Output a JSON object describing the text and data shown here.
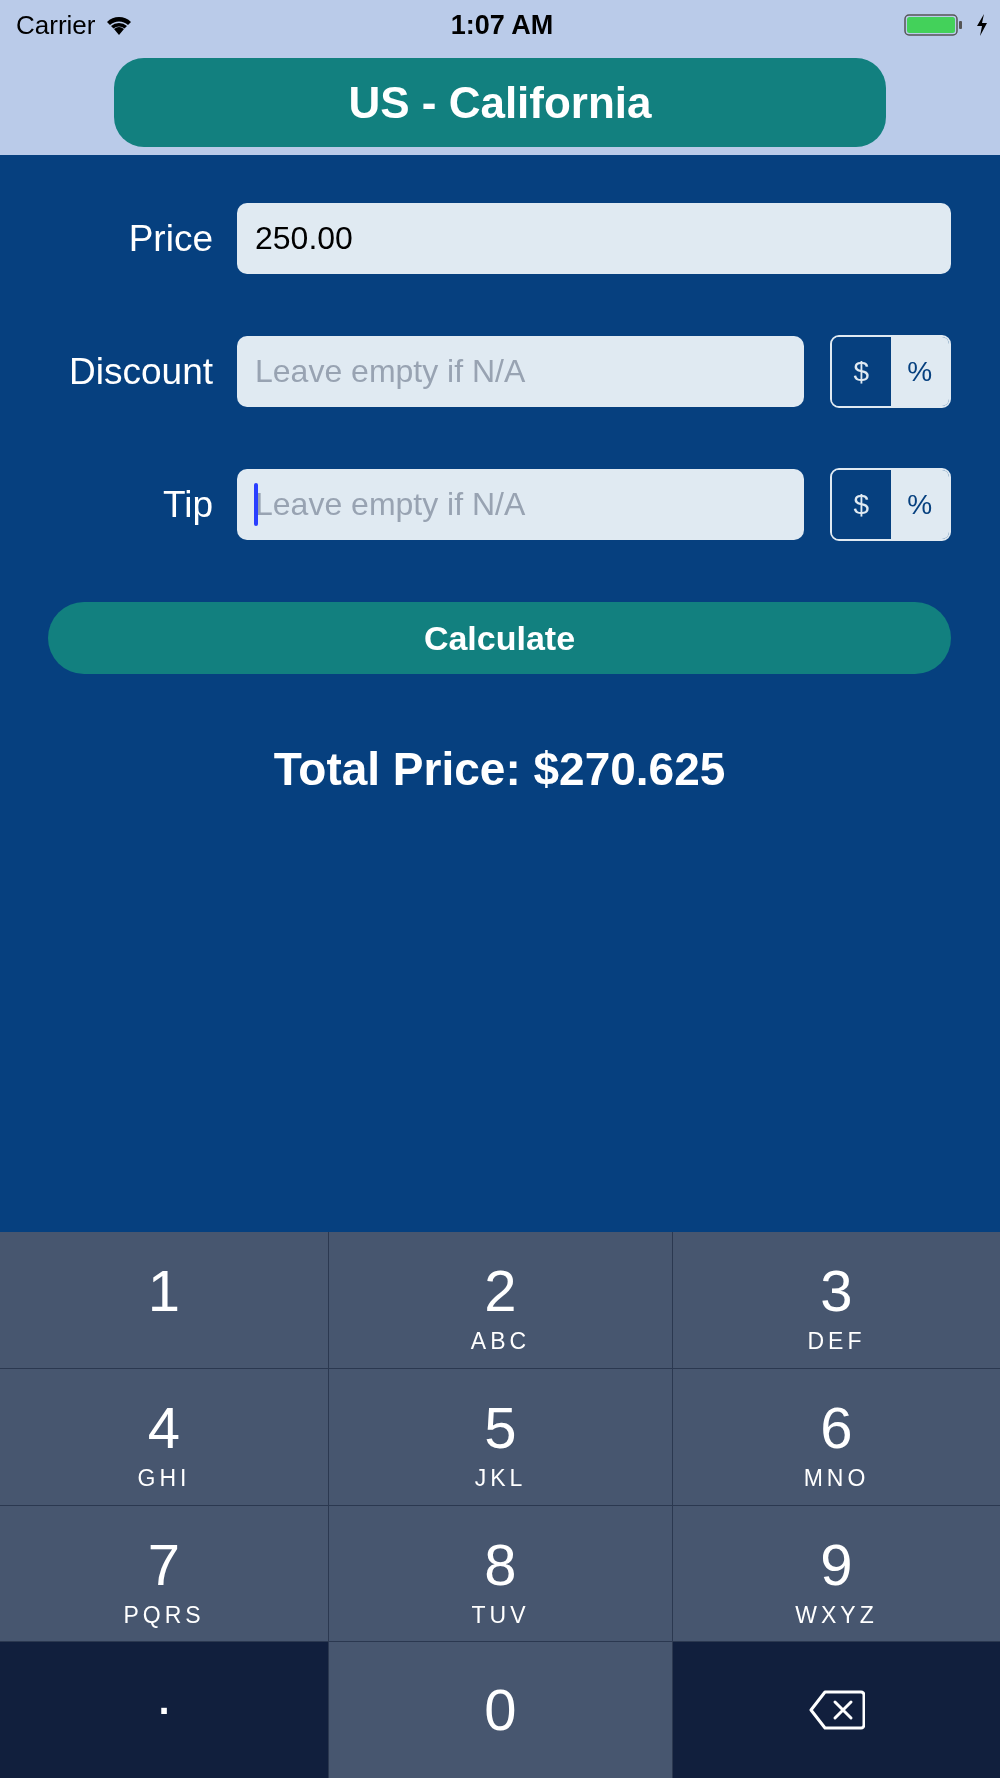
{
  "status_bar": {
    "carrier": "Carrier",
    "time": "1:07 AM"
  },
  "header": {
    "title": "US - California"
  },
  "fields": [
    {
      "label": "Price",
      "value": "250.00",
      "focused": false
    },
    {
      "label": "Discount",
      "placeholder": "Leave empty if N/A",
      "focused": false,
      "units": [
        {
          "label": "$",
          "selected": false
        },
        {
          "label": "%",
          "selected": true
        }
      ]
    },
    {
      "label": "Tip",
      "placeholder": "Leave empty if N/A",
      "focused": true,
      "units": [
        {
          "label": "$",
          "selected": false
        },
        {
          "label": "%",
          "selected": true
        }
      ]
    }
  ],
  "calculate_button": "Calculate",
  "result": "Total Price: $270.625",
  "keypad_rows": [
    {
      "keys": [
        {
          "kind": "digit",
          "digit": "1"
        },
        {
          "kind": "digit",
          "digit": "2",
          "letters": "ABC"
        },
        {
          "kind": "digit",
          "digit": "3",
          "letters": "DEF"
        }
      ]
    },
    {
      "keys": [
        {
          "kind": "digit",
          "digit": "4",
          "letters": "GHI"
        },
        {
          "kind": "digit",
          "digit": "5",
          "letters": "JKL"
        },
        {
          "kind": "digit",
          "digit": "6",
          "letters": "MNO"
        }
      ]
    },
    {
      "keys": [
        {
          "kind": "digit",
          "digit": "7",
          "letters": "PQRS"
        },
        {
          "kind": "digit",
          "digit": "8",
          "letters": "TUV"
        },
        {
          "kind": "digit",
          "digit": "9",
          "letters": "WXYZ"
        }
      ]
    },
    {
      "keys": [
        {
          "kind": "symbol",
          "digit": "."
        },
        {
          "kind": "digit",
          "digit": "0"
        },
        {
          "kind": "delete"
        }
      ]
    }
  ]
}
